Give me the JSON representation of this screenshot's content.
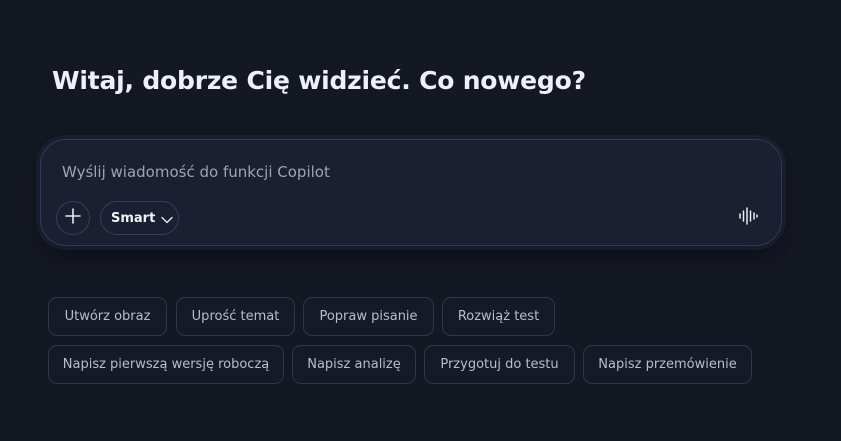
{
  "greeting": "Witaj, dobrze Cię widzieć. Co nowego?",
  "composer": {
    "placeholder": "Wyślij wiadomość do funkcji Copilot",
    "value": "",
    "add_icon": "plus-icon",
    "mode_label": "Smart",
    "mode_icon": "chevron-down-icon",
    "voice_icon": "voice-waveform-icon"
  },
  "suggestions": {
    "row1": [
      "Utwórz obraz",
      "Uprość temat",
      "Popraw pisanie",
      "Rozwiąż test"
    ],
    "row2": [
      "Napisz pierwszą wersję roboczą",
      "Napisz analizę",
      "Przygotuj do testu",
      "Napisz przemówienie"
    ]
  },
  "colors": {
    "background": "#141823",
    "composer_bg": "#1a1f31",
    "composer_border": "#34395a",
    "chip_border": "#30354a",
    "heading_text": "#eef0f6",
    "muted_text": "#9ea3b6"
  }
}
